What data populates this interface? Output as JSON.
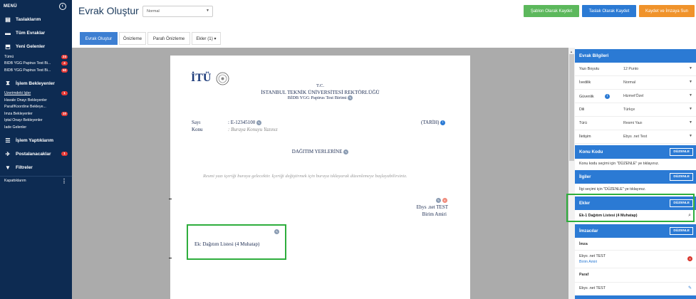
{
  "sidebar": {
    "title": "MENÜ",
    "collapse_icon": "chevron-left-icon",
    "sections": [
      {
        "label": "Taslaklarım",
        "icon": "drafts-icon"
      },
      {
        "label": "Tüm Evraklar",
        "icon": "folder-icon"
      },
      {
        "label": "Yeni Gelenler",
        "icon": "inbox-icon"
      }
    ],
    "inbox_items": [
      {
        "label": "Tümü",
        "badge": "24"
      },
      {
        "label": "BİDB YGG Papirus Test Bi...",
        "badge": "4"
      },
      {
        "label": "BİDB YGG Papirus Test Bi...",
        "badge": "50"
      }
    ],
    "pending_section": {
      "label": "İşlem Bekleyenler",
      "icon": "hourglass-icon"
    },
    "pending_items": [
      {
        "label": "Üzerimdeki İşler",
        "badge": "1"
      },
      {
        "label": "Havale Onayı Bekleyenler",
        "badge": ""
      },
      {
        "label": "Paraf/Koordine Bekleye...",
        "badge": ""
      },
      {
        "label": "İmza Bekleyenler",
        "badge": "10"
      },
      {
        "label": "İptal Onayı Bekleyenler",
        "badge": ""
      },
      {
        "label": "İade Gelenler",
        "badge": ""
      }
    ],
    "done_section": {
      "label": "İşlem Yaptıklarım",
      "icon": "done-list-icon"
    },
    "mail_section": {
      "label": "Postalanacaklar",
      "icon": "mail-icon",
      "badge": "1"
    },
    "filter_section": {
      "label": "Filtreler",
      "icon": "filter-icon"
    },
    "closed_label": "Kapattıklarım"
  },
  "header": {
    "title": "Evrak Oluştur",
    "priority_value": "Normal",
    "buttons": {
      "template_save": "Şablon Olarak Kaydet",
      "draft_save": "Taslak Olarak Kaydet",
      "save_sign": "Kaydet ve İmzaya Sun"
    },
    "colors": {
      "green": "#5cb85c",
      "blue": "#2b7ad4",
      "orange": "#f0932b"
    }
  },
  "tabs": [
    "Evrak Oluştur",
    "Önizleme",
    "Parafı Önizleme",
    "Ekler (1) ▾"
  ],
  "document": {
    "logo_text": "İTÜ",
    "tc": "T.C.",
    "university": "İSTANBUL TEKNİK ÜNİVERSİTESİ REKTÖRLÜĞÜ",
    "unit": "BİDB YGG Papirus Test Birimi",
    "sayi_label": "Sayı",
    "sayi_value": ": E-12345100",
    "konu_label": "Konu",
    "konu_value": ": Buraya Konuyu Yazınız",
    "date_label": "(TARİH)",
    "distribution_title": "DAĞITIM YERLERİNE",
    "body_text": "Resmi yazı içeriği buraya gelecektir. İçeriği değiştirmek için buraya tıklayarak düzenlemeye başlayabilirsiniz.",
    "signer_name": "Ebys .net TEST",
    "signer_title": "Birim Amiri",
    "attachment": "Ek:    Dağıtım Listesi (4 Muhatap)"
  },
  "panel": {
    "header": "Evrak Bilgileri",
    "fields": [
      {
        "key": "Yazı Boyutu",
        "value": "12 Punto"
      },
      {
        "key": "İvedilik",
        "value": "Normal"
      },
      {
        "key": "Güvenlik",
        "value": "Hizmet'Özel"
      },
      {
        "key": "Dili",
        "value": "Türkçe"
      },
      {
        "key": "Türü",
        "value": "Resmi Yazı"
      },
      {
        "key": "İletişim",
        "value": "Ebys .net Test"
      }
    ],
    "konu_kodu": {
      "title": "Konu Kodu",
      "button": "DÜZENLE",
      "hint": "Konu kodu seçimi için \"DÜZENLE\" ye tıklayınız."
    },
    "ilgiler": {
      "title": "İlgiler",
      "button": "DÜZENLE",
      "hint": "İlgi seçimi için \"DÜZENLE\" ye tıklayınız."
    },
    "ekler": {
      "title": "Ekler",
      "button": "DÜZENLE",
      "item": "Ek-1 Dağıtım Listesi (4 Muhatap)"
    },
    "imzacilar": {
      "title": "İmzacılar",
      "button": "DÜZENLE"
    },
    "imza_label": "İmza",
    "imza_name": "Ebys .net TEST",
    "imza_title": "Birim Amiri",
    "paraf_label": "Paraf",
    "paraf_name": "Ebys .net TEST"
  }
}
